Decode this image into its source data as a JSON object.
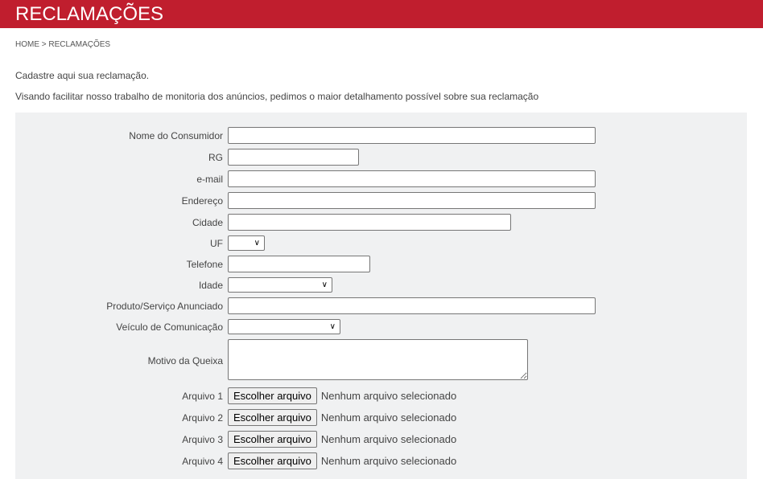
{
  "header": {
    "title": "RECLAMAÇÕES"
  },
  "breadcrumb": "HOME > RECLAMAÇÕES",
  "intro": {
    "line1": "Cadastre aqui sua reclamação.",
    "line2": "Visando facilitar nosso trabalho de monitoria dos anúncios, pedimos o maior detalhamento possível sobre sua reclamação"
  },
  "form": {
    "nome": {
      "label": "Nome do Consumidor",
      "value": ""
    },
    "rg": {
      "label": "RG",
      "value": ""
    },
    "email": {
      "label": "e-mail",
      "value": ""
    },
    "endereco": {
      "label": "Endereço",
      "value": ""
    },
    "cidade": {
      "label": "Cidade",
      "value": ""
    },
    "uf": {
      "label": "UF",
      "value": ""
    },
    "telefone": {
      "label": "Telefone",
      "value": ""
    },
    "idade": {
      "label": "Idade",
      "value": ""
    },
    "produto": {
      "label": "Produto/Serviço Anunciado",
      "value": ""
    },
    "veiculo": {
      "label": "Veículo de Comunicação",
      "value": ""
    },
    "motivo": {
      "label": "Motivo da Queixa",
      "value": ""
    },
    "arquivos": [
      {
        "label": "Arquivo 1",
        "button": "Escolher arquivo",
        "status": "Nenhum arquivo selecionado"
      },
      {
        "label": "Arquivo 2",
        "button": "Escolher arquivo",
        "status": "Nenhum arquivo selecionado"
      },
      {
        "label": "Arquivo 3",
        "button": "Escolher arquivo",
        "status": "Nenhum arquivo selecionado"
      },
      {
        "label": "Arquivo 4",
        "button": "Escolher arquivo",
        "status": "Nenhum arquivo selecionado"
      }
    ]
  },
  "colors": {
    "header_bg": "#c01e2e",
    "panel_bg": "#f0f1f2"
  },
  "icons": {
    "select_arrow": "chevron-down-icon"
  }
}
